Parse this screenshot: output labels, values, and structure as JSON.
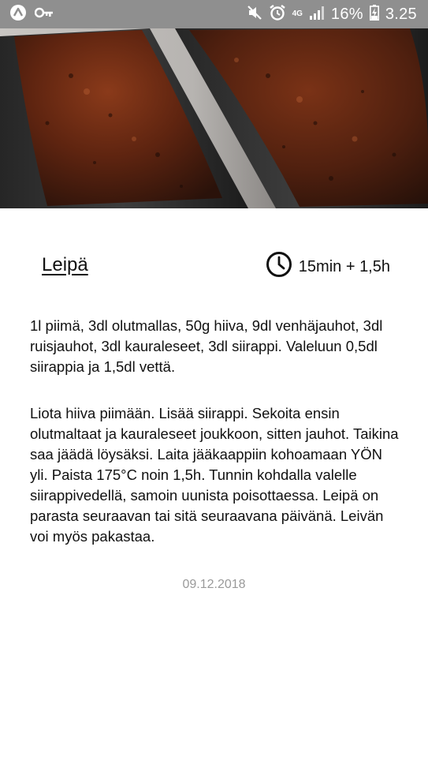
{
  "status_bar": {
    "network": "4G",
    "battery_percent": "16%",
    "time": "3.25",
    "icons": [
      "app-notification-icon",
      "key-icon",
      "mute-icon",
      "alarm-icon",
      "signal-icon",
      "battery-charging-icon"
    ]
  },
  "recipe": {
    "title": "Leipä",
    "time": "15min + 1,5h",
    "ingredients": "1l piimä, 3dl olutmallas, 50g hiiva, 9dl venhäjauhot, 3dl ruisjauhot, 3dl kauraleseet, 3dl siirappi. Valeluun 0,5dl siirappia ja 1,5dl vettä.",
    "instructions": "Liota hiiva piimään. Lisää siirappi. Sekoita ensin olutmaltaat ja kauraleseet joukkoon, sitten jauhot. Taikina saa jäädä löysäksi. Laita jääkaappiin kohoamaan YÖN yli. Paista 175°C noin 1,5h. Tunnin kohdalla valelle siirappivedellä, samoin uunista poisottaessa. Leipä on parasta seuraavan tai sitä seuraavana päivänä. Leivän voi myös pakastaa.",
    "date": "09.12.2018"
  },
  "colors": {
    "status_bar": "#8f8f8f",
    "date_text": "#9a9a9a"
  }
}
